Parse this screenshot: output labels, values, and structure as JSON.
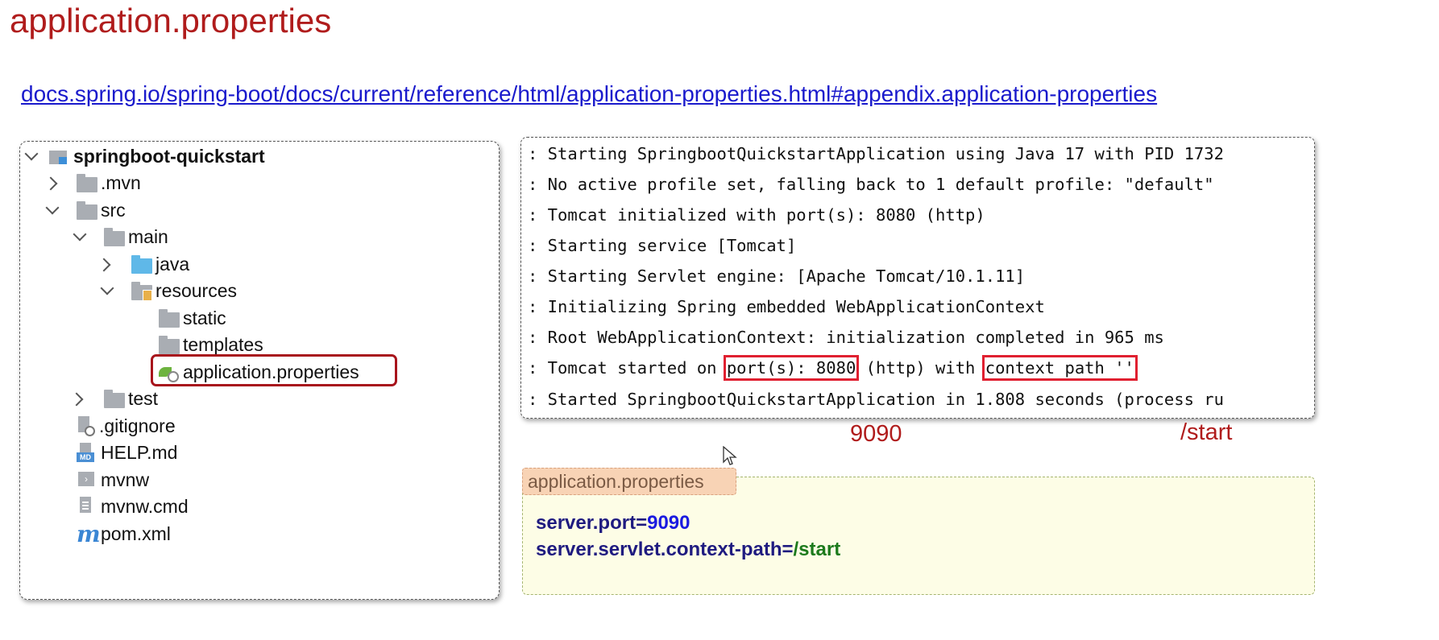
{
  "page_title": "application.properties",
  "doc_link": "docs.spring.io/spring-boot/docs/current/reference/html/application-properties.html#appendix.application-properties",
  "tree": {
    "project": "springboot-quickstart",
    "items": [
      {
        "label": ".mvn"
      },
      {
        "label": "src"
      },
      {
        "label": "main"
      },
      {
        "label": "java"
      },
      {
        "label": "resources"
      },
      {
        "label": "static"
      },
      {
        "label": "templates"
      },
      {
        "label": "application.properties"
      },
      {
        "label": "test"
      },
      {
        "label": ".gitignore"
      },
      {
        "label": "HELP.md"
      },
      {
        "label": "mvnw"
      },
      {
        "label": "mvnw.cmd"
      },
      {
        "label": "pom.xml"
      }
    ],
    "icons": {
      "md_badge": "MD",
      "maven": "m"
    }
  },
  "console": {
    "lines": [
      ": Starting SpringbootQuickstartApplication using Java 17 with PID 1732",
      ": No active profile set, falling back to 1 default profile: \"default\"",
      ": Tomcat initialized with port(s): 8080 (http)",
      ": Starting service [Tomcat]",
      ": Starting Servlet engine: [Apache Tomcat/10.1.11]",
      ": Initializing Spring embedded WebApplicationContext",
      ": Root WebApplicationContext: initialization completed in 965 ms",
      ": Started SpringbootQuickstartApplication in 1.808 seconds (process ru"
    ],
    "started_line": {
      "prefix": ": Tomcat started on ",
      "port_highlight": "port(s): 8080",
      "middle": " (http) with ",
      "context_highlight": "context path ''"
    }
  },
  "annotations": {
    "port": "9090",
    "context": "/start"
  },
  "props": {
    "tab": "application.properties",
    "line1_key": "server.port",
    "line1_val": "9090",
    "line2_key": "server.servlet.context-path",
    "line2_val": "/start",
    "equals": "="
  }
}
